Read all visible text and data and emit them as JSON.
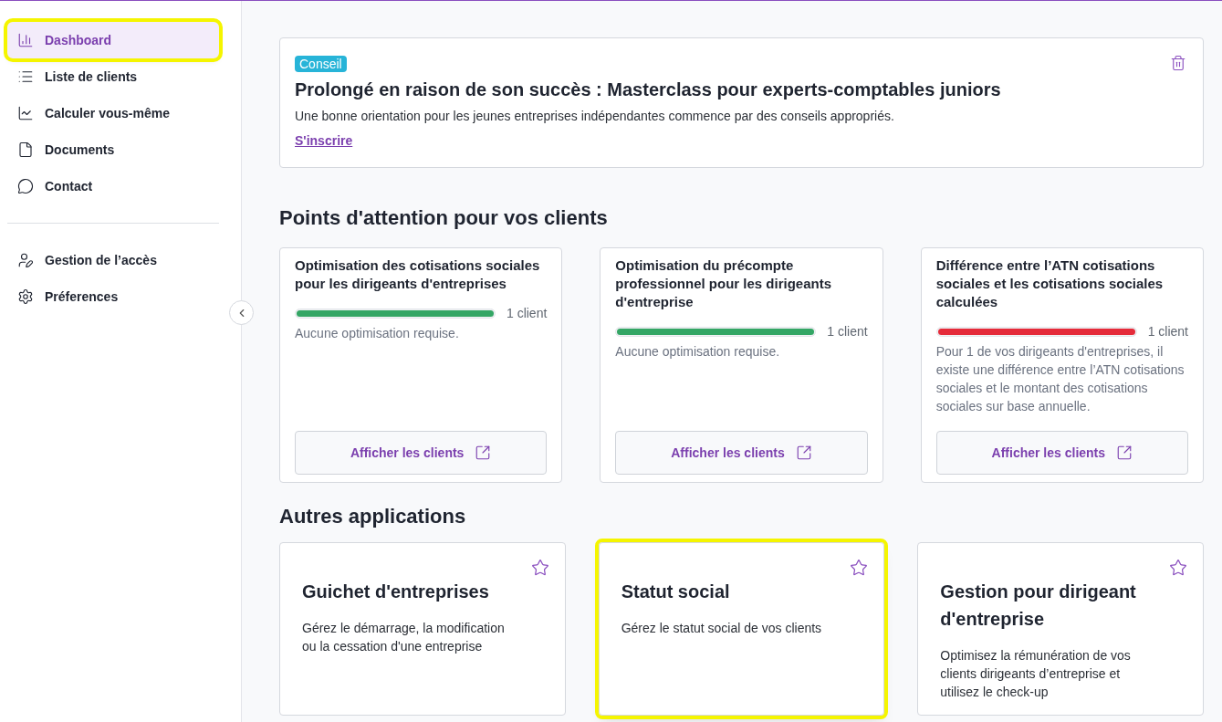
{
  "sidebar": {
    "items": [
      {
        "label": "Dashboard",
        "selected": true,
        "highlighted": true
      },
      {
        "label": "Liste de clients",
        "selected": false,
        "highlighted": false
      },
      {
        "label": "Calculer vous-même",
        "selected": false,
        "highlighted": false
      },
      {
        "label": "Documents",
        "selected": false,
        "highlighted": false
      },
      {
        "label": "Contact",
        "selected": false,
        "highlighted": false
      }
    ],
    "secondary_items": [
      {
        "label": "Gestion de l’accès",
        "selected": false
      },
      {
        "label": "Préferences",
        "selected": false
      }
    ]
  },
  "banner": {
    "badge": "Conseil",
    "title": "Prolongé en raison de son succès : Masterclass pour experts-comptables juniors",
    "text": "Une bonne orientation pour les jeunes entreprises indépendantes commence par des conseils appropriés.",
    "link": "S'inscrire"
  },
  "attention": {
    "heading": "Points d'attention pour vos clients",
    "cards": [
      {
        "title": "Optimisation des cotisations sociales pour les dirigeants d'entreprises",
        "level": 1,
        "color": "#34a665",
        "count": "1 client",
        "text": "Aucune optimisation requise.",
        "button": "Afficher les clients"
      },
      {
        "title": "Optimisation du précompte professionnel pour les dirigeants d'entreprise",
        "level": 1,
        "color": "#34a665",
        "count": "1 client",
        "text": "Aucune optimisation requise.",
        "button": "Afficher les clients"
      },
      {
        "title": "Différence entre l’ATN cotisations sociales et les cotisations sociales calculées",
        "level": 1,
        "color": "#e52b3a",
        "count": "1 client",
        "text": "Pour 1 de vos dirigeants d'entreprises, il existe une différence entre l’ATN cotisations sociales et le montant des cotisations sociales sur base annuelle.",
        "button": "Afficher les clients"
      }
    ]
  },
  "apps": {
    "heading": "Autres applications",
    "cards": [
      {
        "title": "Guichet d'entreprises",
        "text": "Gérez le démarrage, la modification ou la cessation d'une entreprise",
        "favorite": false,
        "highlighted": false
      },
      {
        "title": "Statut social",
        "text": "Gérez le statut social de vos clients",
        "favorite": false,
        "highlighted": true
      },
      {
        "title": "Gestion pour dirigeant d'entreprise",
        "text": "Optimisez la rémunération de vos clients dirigeants d’entreprise et utilisez le check-up",
        "favorite": false,
        "highlighted": false
      }
    ]
  }
}
